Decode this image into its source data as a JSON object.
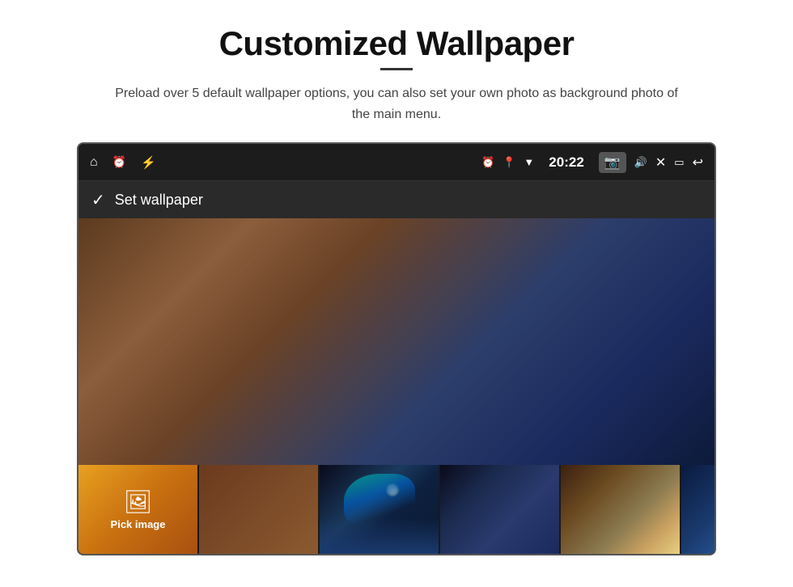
{
  "page": {
    "title": "Customized Wallpaper",
    "subtitle": "Preload over 5 default wallpaper options, you can also set your own photo as background photo of the main menu.",
    "divider": true
  },
  "statusBar": {
    "leftIcons": [
      "home",
      "alarm",
      "usb"
    ],
    "rightIcons": [
      "alarm",
      "location",
      "wifi",
      "time",
      "camera",
      "volume",
      "close",
      "window",
      "back"
    ],
    "time": "20:22"
  },
  "wallpaperScreen": {
    "setWallpaperLabel": "Set wallpaper",
    "checkmark": "✓",
    "pickImageLabel": "Pick image"
  }
}
